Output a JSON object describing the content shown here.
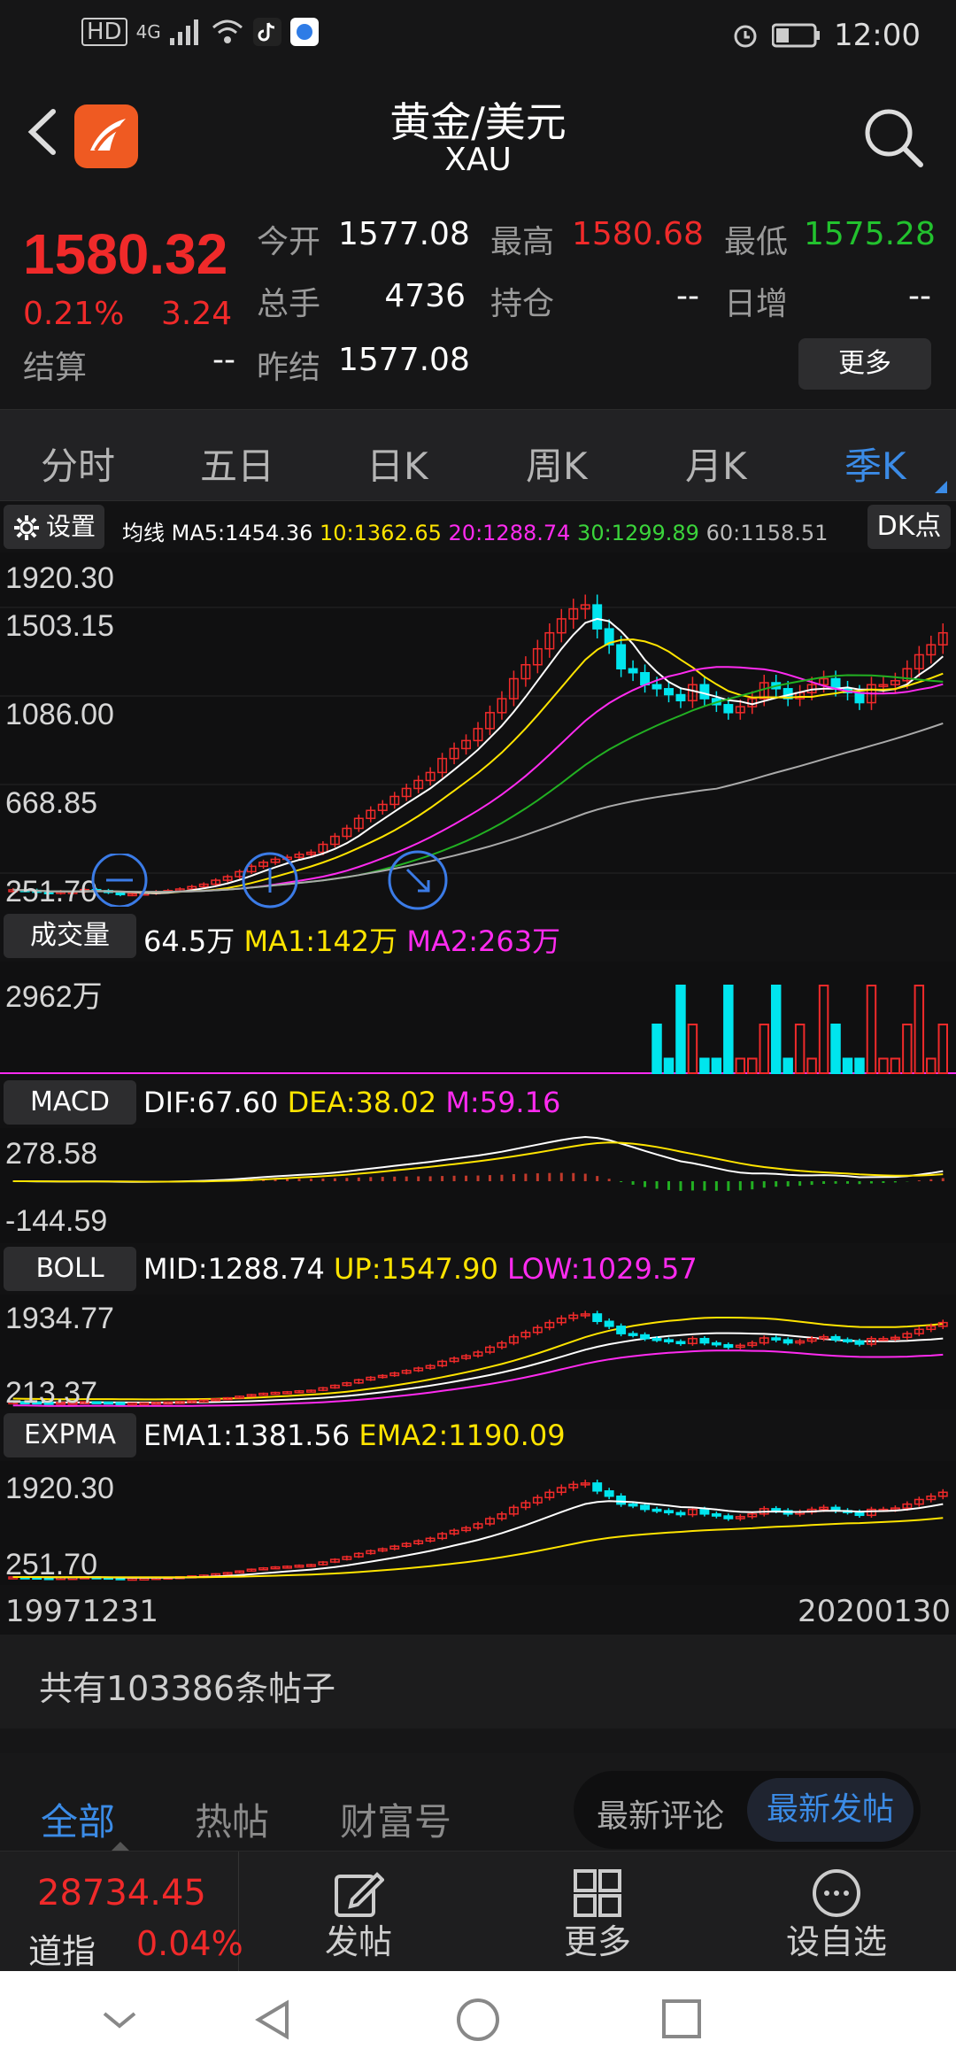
{
  "status_bar": {
    "network": "4G",
    "hd": "HD",
    "time": "12:00"
  },
  "header": {
    "title": "黄金/美元",
    "subtitle": "XAU"
  },
  "quote": {
    "price": "1580.32",
    "change_pct": "0.21%",
    "change_value": "3.24",
    "settle_label": "结算",
    "settle_value": "--",
    "open_label": "今开",
    "open_value": "1577.08",
    "high_label": "最高",
    "high_value": "1580.68",
    "low_label": "最低",
    "low_value": "1575.28",
    "volume_label": "总手",
    "volume_value": "4736",
    "oi_label": "持仓",
    "oi_value": "--",
    "daily_inc_label": "日增",
    "daily_inc_value": "--",
    "prev_settle_label": "昨结",
    "prev_settle_value": "1577.08",
    "more_label": "更多"
  },
  "period_tabs": [
    "分时",
    "五日",
    "日K",
    "周K",
    "月K",
    "季K"
  ],
  "ma_bar": {
    "settings_label": "设置",
    "ma_label": "均线",
    "ma5": "MA5:1454.36",
    "ma10": "10:1362.65",
    "ma20": "20:1288.74",
    "ma30": "30:1299.89",
    "ma60": "60:1158.51",
    "dk_label": "DK点"
  },
  "price_axis": [
    "1920.30",
    "1503.15",
    "1086.00",
    "668.85",
    "251.70"
  ],
  "volume_bar": {
    "button": "成交量",
    "value": "64.5万",
    "ma1": "MA1:142万",
    "ma2": "MA2:263万",
    "axis": "2962万"
  },
  "macd_bar": {
    "button": "MACD",
    "dif": "DIF:67.60",
    "dea": "DEA:38.02",
    "m": "M:59.16",
    "axis_top": "278.58",
    "axis_bottom": "-144.59"
  },
  "boll_bar": {
    "button": "BOLL",
    "mid": "MID:1288.74",
    "up": "UP:1547.90",
    "low": "LOW:1029.57",
    "axis_top": "1934.77",
    "axis_bottom": "213.37"
  },
  "expma_bar": {
    "button": "EXPMA",
    "ema1": "EMA1:1381.56",
    "ema2": "EMA2:1190.09",
    "axis_top": "1920.30",
    "axis_bottom": "251.70"
  },
  "dates": {
    "start": "19971231",
    "end": "20200130"
  },
  "posts": {
    "count_text": "共有103386条帖子"
  },
  "forum_tabs": {
    "all": "全部",
    "hot": "热帖",
    "wealth": "财富号",
    "latest_comment": "最新评论",
    "latest_post": "最新发帖"
  },
  "bottom_nav": {
    "index_value": "28734.45",
    "index_name": "道指",
    "index_change": "0.04%",
    "post": "发帖",
    "more": "更多",
    "watchlist": "设自选"
  },
  "chart_data": {
    "type": "candlestick",
    "x_range": [
      "19971231",
      "20200130"
    ],
    "ylim": [
      251.7,
      1920.3
    ],
    "close": [
      292,
      289,
      282,
      276,
      283,
      283,
      293,
      288,
      279,
      268,
      272,
      275,
      283,
      288,
      296,
      308,
      320,
      340,
      358,
      383,
      410,
      430,
      445,
      455,
      470,
      480,
      520,
      560,
      600,
      650,
      690,
      720,
      760,
      800,
      840,
      880,
      950,
      1000,
      1040,
      1100,
      1180,
      1250,
      1350,
      1420,
      1500,
      1580,
      1650,
      1700,
      1720,
      1600,
      1520,
      1400,
      1380,
      1320,
      1300,
      1270,
      1240,
      1320,
      1250,
      1220,
      1180,
      1210,
      1250,
      1330,
      1300,
      1250,
      1280,
      1320,
      1350,
      1300,
      1280,
      1230,
      1320,
      1320,
      1340,
      1400,
      1470,
      1520,
      1580
    ]
  }
}
